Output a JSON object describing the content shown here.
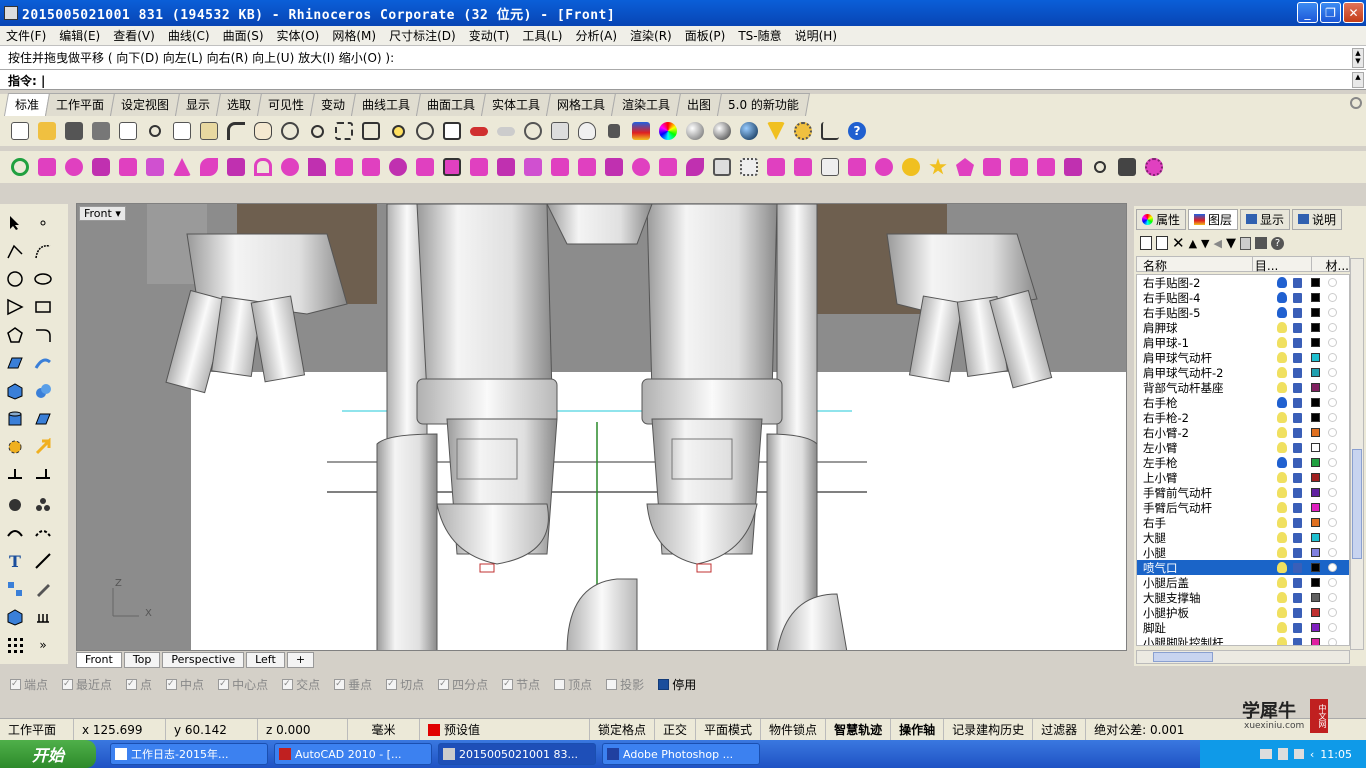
{
  "window": {
    "title": "2015005021001 831 (194532 KB) - Rhinoceros Corporate (32 位元) - [Front]",
    "min_label": "_",
    "max_label": "❐",
    "close_label": "✕"
  },
  "menu": [
    "文件(F)",
    "编辑(E)",
    "查看(V)",
    "曲线(C)",
    "曲面(S)",
    "实体(O)",
    "网格(M)",
    "尺寸标注(D)",
    "变动(T)",
    "工具(L)",
    "分析(A)",
    "渲染(R)",
    "面板(P)",
    "TS-随意",
    "说明(H)"
  ],
  "command": {
    "history": "按住并拖曳做平移 ( 向下(D)  向左(L)  向右(R)  向上(U)  放大(I)  缩小(O) ):",
    "prompt": "指令:"
  },
  "toolbar_tabs": [
    "标准",
    "工作平面",
    "设定视图",
    "显示",
    "选取",
    "可见性",
    "变动",
    "曲线工具",
    "曲面工具",
    "实体工具",
    "网格工具",
    "渲染工具",
    "出图",
    "5.0 的新功能"
  ],
  "viewport": {
    "label": "Front",
    "axis_z": "Z",
    "axis_x": "X"
  },
  "view_tabs": [
    "Front",
    "Top",
    "Perspective",
    "Left"
  ],
  "view_tab_add": "+",
  "osnaps": [
    {
      "label": "端点",
      "checked": true
    },
    {
      "label": "最近点",
      "checked": true
    },
    {
      "label": "点",
      "checked": true
    },
    {
      "label": "中点",
      "checked": true
    },
    {
      "label": "中心点",
      "checked": true
    },
    {
      "label": "交点",
      "checked": true
    },
    {
      "label": "垂点",
      "checked": true
    },
    {
      "label": "切点",
      "checked": true
    },
    {
      "label": "四分点",
      "checked": true
    },
    {
      "label": "节点",
      "checked": true
    },
    {
      "label": "顶点",
      "checked": false
    },
    {
      "label": "投影",
      "checked": false
    },
    {
      "label": "停用",
      "checked": true
    }
  ],
  "status": {
    "cplane": "工作平面",
    "x": "x 125.699",
    "y": "y 60.142",
    "z": "z 0.000",
    "unit": "毫米",
    "layer": "预设值",
    "grid_snap": "锁定格点",
    "ortho": "正交",
    "planar": "平面模式",
    "osnap": "物件锁点",
    "smarttrack": "智慧轨迹",
    "gumball": "操作轴",
    "history": "记录建构历史",
    "filter": "过滤器",
    "tolerance": "绝对公差: 0.001"
  },
  "panel": {
    "tabs": [
      "属性",
      "图层",
      "显示",
      "说明"
    ],
    "col_name": "名称",
    "col_obj": "目...",
    "col_mat": "材..."
  },
  "layers": [
    {
      "name": "右手贴图-2",
      "color": "#000000",
      "bulb": "#2060d0"
    },
    {
      "name": "右手贴图-4",
      "color": "#000000",
      "bulb": "#2060d0"
    },
    {
      "name": "右手贴图-5",
      "color": "#000000",
      "bulb": "#2060d0"
    },
    {
      "name": "肩胛球",
      "color": "#000000",
      "bulb": "#f0e060"
    },
    {
      "name": "肩甲球-1",
      "color": "#000000",
      "bulb": "#f0e060"
    },
    {
      "name": "肩甲球气动杆",
      "color": "#20c0d0",
      "bulb": "#f0e060"
    },
    {
      "name": "肩甲球气动杆-2",
      "color": "#20a0b0",
      "bulb": "#f0e060"
    },
    {
      "name": "背部气动杆基座",
      "color": "#802060",
      "bulb": "#f0e060"
    },
    {
      "name": "右手枪",
      "color": "#000000",
      "bulb": "#2060d0"
    },
    {
      "name": "右手枪-2",
      "color": "#000000",
      "bulb": "#f0e060"
    },
    {
      "name": "右小臂-2",
      "color": "#e07020",
      "bulb": "#f0e060"
    },
    {
      "name": "左小臂",
      "color": "#ffffff",
      "bulb": "#f0e060"
    },
    {
      "name": "左手枪",
      "color": "#20a040",
      "bulb": "#2060d0"
    },
    {
      "name": "上小臂",
      "color": "#a02020",
      "bulb": "#f0e060"
    },
    {
      "name": "手臂前气动杆",
      "color": "#6020a0",
      "bulb": "#f0e060"
    },
    {
      "name": "手臂后气动杆",
      "color": "#e020c0",
      "bulb": "#f0e060"
    },
    {
      "name": "右手",
      "color": "#e07020",
      "bulb": "#f0e060"
    },
    {
      "name": "大腿",
      "color": "#20c0d0",
      "bulb": "#f0e060"
    },
    {
      "name": "小腿",
      "color": "#8080e0",
      "bulb": "#f0e060"
    },
    {
      "name": "喷气口",
      "color": "#000000",
      "bulb": "#f0e060",
      "selected": true
    },
    {
      "name": "小腿后盖",
      "color": "#000000",
      "bulb": "#f0e060"
    },
    {
      "name": "大腿支撑轴",
      "color": "#606060",
      "bulb": "#f0e060"
    },
    {
      "name": "小腿护板",
      "color": "#c03030",
      "bulb": "#f0e060"
    },
    {
      "name": "脚趾",
      "color": "#8020c0",
      "bulb": "#f0e060"
    },
    {
      "name": "小腿脚趾控制杆",
      "color": "#e020a0",
      "bulb": "#f0e060"
    }
  ],
  "taskbar": {
    "start": "开始",
    "tasks": [
      "工作日志-2015年...",
      "AutoCAD 2010 - [...",
      "2015005021001 83...",
      "Adobe Photoshop ..."
    ],
    "clock": "11:05"
  },
  "watermark": {
    "text": "学犀牛",
    "sub": "xuexiniu.com",
    "badge": "中文网"
  }
}
